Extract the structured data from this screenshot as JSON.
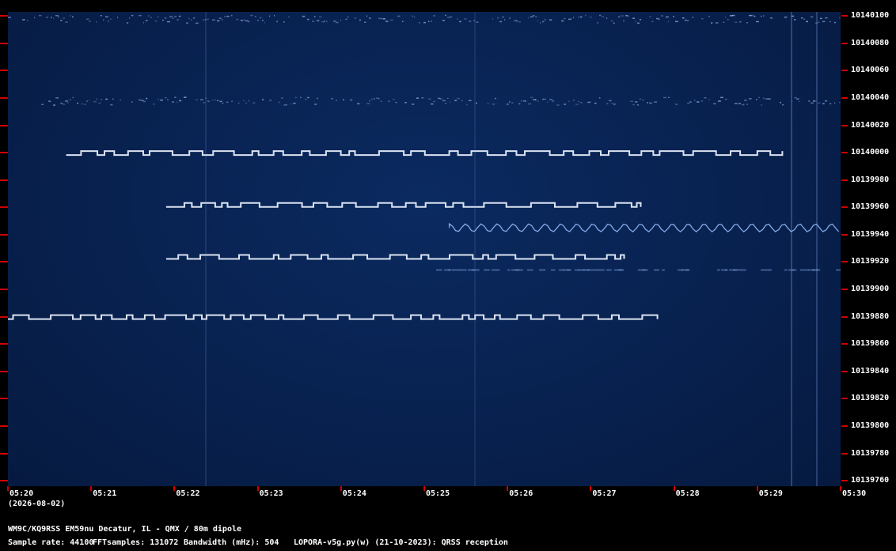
{
  "chart_data": {
    "type": "heatmap",
    "title": "",
    "date_label": "(2026-08-02)",
    "x_tick_labels": [
      "05:20",
      "05:21",
      "05:22",
      "05:23",
      "05:24",
      "05:25",
      "05:26",
      "05:27",
      "05:28",
      "05:29",
      "05:30"
    ],
    "y_tick_labels": [
      "10140100",
      "10140080",
      "10140060",
      "10140040",
      "10140020",
      "10140000",
      "10139980",
      "10139960",
      "10139940",
      "10139920",
      "10139900",
      "10139880",
      "10139860",
      "10139840",
      "10139820",
      "10139800",
      "10139780",
      "10139760"
    ],
    "x_range_minutes": [
      "05:20",
      "05:30"
    ],
    "y_range_hz": [
      10139756,
      10140103
    ],
    "signal_traces": [
      {
        "freq_hz": 10140000,
        "start": "05:20.7",
        "end": "05:29.3",
        "style": "morse-shift"
      },
      {
        "freq_hz": 10139962,
        "start": "05:21.9",
        "end": "05:27.6",
        "style": "morse-shift"
      },
      {
        "freq_hz": 10139924,
        "start": "05:21.9",
        "end": "05:27.4",
        "style": "morse-shift"
      },
      {
        "freq_hz": 10139880,
        "start": "05:20.0",
        "end": "05:27.8",
        "style": "morse-shift"
      },
      {
        "freq_hz": 10139945,
        "start": "05:25.3",
        "end": "05:30.0",
        "style": "wavy"
      },
      {
        "freq_hz": 10140038,
        "start": "05:20.4",
        "end": "05:30.0",
        "style": "noise-band"
      },
      {
        "freq_hz": 10140098,
        "start": "05:20.0",
        "end": "05:30.0",
        "style": "noise-band"
      },
      {
        "freq_hz": 10139914,
        "start": "05:25.0",
        "end": "05:30.0",
        "style": "faint"
      }
    ]
  },
  "footer": {
    "station": "WM9C/KQ9RSS EM59nu Decatur, IL - QMX / 80m dipole",
    "sample_rate": "Sample rate: 44100",
    "fft_samples": "FFTsamples: 131072",
    "bandwidth": "Bandwidth (mHz): 504",
    "software": "LOPORA-v5g.py(w) (21-10-2023): QRSS reception"
  }
}
